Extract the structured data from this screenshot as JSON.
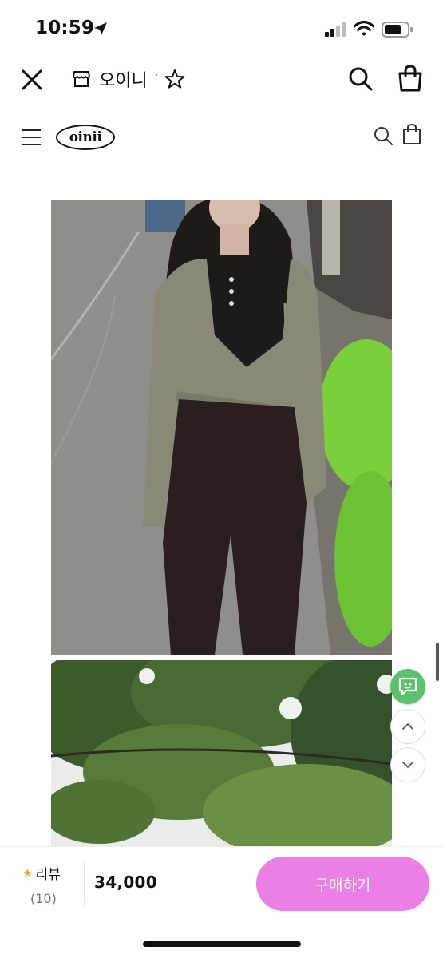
{
  "status_bar": {
    "time": "10:59"
  },
  "header": {
    "store_name": "오이니",
    "separator": "·"
  },
  "site": {
    "logo_text": "oinii"
  },
  "icons": {
    "close": "close-icon",
    "store": "store-icon",
    "star": "star-icon",
    "search": "search-icon",
    "bag": "shopping-bag-icon",
    "menu": "hamburger-menu-icon",
    "chat": "chat-icon",
    "up": "chevron-up-icon",
    "down": "chevron-down-icon"
  },
  "bottom_bar": {
    "review_label": "리뷰",
    "review_count": "(10)",
    "price": "34,000",
    "buy_label": "구매하기"
  },
  "colors": {
    "buy_button": "#ea7fe4",
    "chat_button": "#5ec06b",
    "review_star": "#f0a030"
  }
}
